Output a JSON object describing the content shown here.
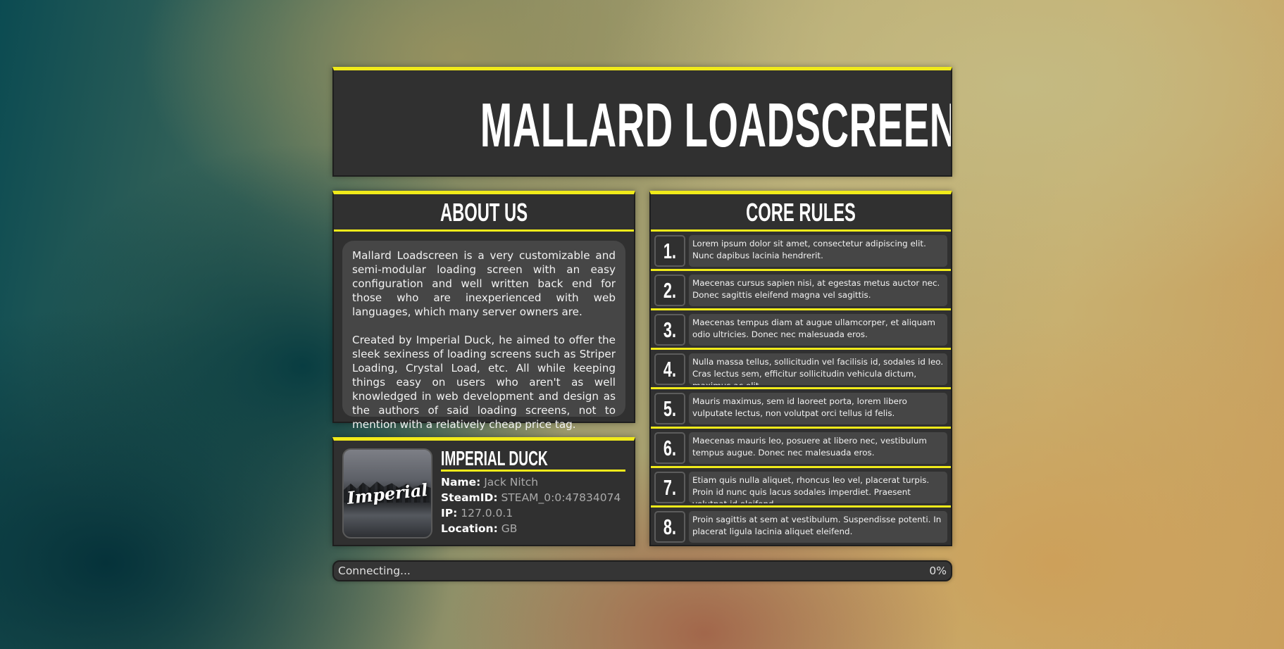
{
  "header": {
    "title": "MALLARD LOADSCREEN"
  },
  "about": {
    "heading": "ABOUT US",
    "paragraphs": [
      "Mallard Loadscreen is a very customizable and semi-modular loading screen with an easy configuration and well written back end for those who are inexperienced with web languages, which many server owners are.",
      "Created by Imperial Duck, he aimed to offer the sleek sexiness of loading screens such as Striper Loading, Crystal Load, etc. All while keeping things easy on users who aren't as well knowledged in web development and design as the authors of said loading screens, not to mention with a relatively cheap price tag."
    ]
  },
  "profile": {
    "display_name": "IMPERIAL DUCK",
    "avatar_text": "Imperial",
    "fields": [
      {
        "label": "Name:",
        "value": "Jack Nitch"
      },
      {
        "label": "SteamID:",
        "value": "STEAM_0:0:47834074"
      },
      {
        "label": "IP:",
        "value": "127.0.0.1"
      },
      {
        "label": "Location:",
        "value": "GB"
      }
    ]
  },
  "rules": {
    "heading": "CORE RULES",
    "items": [
      {
        "number": "1.",
        "text": "Lorem ipsum dolor sit amet, consectetur adipiscing elit. Nunc dapibus lacinia hendrerit."
      },
      {
        "number": "2.",
        "text": "Maecenas cursus sapien nisi, at egestas metus auctor nec. Donec sagittis eleifend magna vel sagittis."
      },
      {
        "number": "3.",
        "text": "Maecenas tempus diam at augue ullamcorper, et aliquam odio ultricies. Donec nec malesuada eros."
      },
      {
        "number": "4.",
        "text": "Nulla massa tellus, sollicitudin vel facilisis id, sodales id leo. Cras lectus sem, efficitur sollicitudin vehicula dictum, maximus ac elit."
      },
      {
        "number": "5.",
        "text": "Mauris maximus, sem id laoreet porta, lorem libero vulputate lectus, non volutpat orci tellus id felis."
      },
      {
        "number": "6.",
        "text": "Maecenas mauris leo, posuere at libero nec, vestibulum tempus augue. Donec nec malesuada eros."
      },
      {
        "number": "7.",
        "text": "Etiam quis nulla aliquet, rhoncus leo vel, placerat turpis. Proin id nunc quis lacus sodales imperdiet. Praesent volutpat id eleifend."
      },
      {
        "number": "8.",
        "text": "Proin sagittis at sem at vestibulum. Suspendisse potenti. In placerat ligula lacinia aliquet eleifend."
      }
    ]
  },
  "progress": {
    "status": "Connecting...",
    "percent_label": "0%",
    "fraction": 0
  },
  "colors": {
    "accent": "#f0ea1a",
    "panel": "#303030",
    "inner": "#464646"
  }
}
